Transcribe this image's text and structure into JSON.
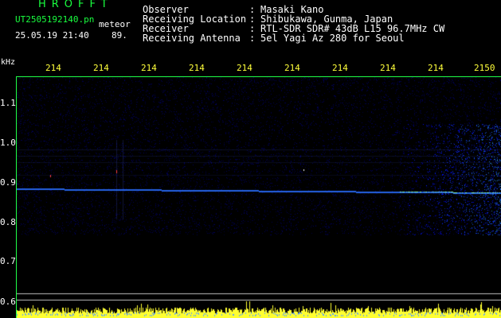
{
  "header": {
    "app_title": "HROFFT",
    "file_name": "UT2505192140.pn",
    "detection_label": "meteor",
    "timestamp": "25.05.19 21:40",
    "count": "89."
  },
  "station_info": [
    {
      "label": "Observer",
      "value": "Masaki Kano"
    },
    {
      "label": "Receiving Location",
      "value": "Shibukawa, Gunma, Japan"
    },
    {
      "label": "Receiver",
      "value": "RTL-SDR SDR# 43dB L15 96.7MHz CW"
    },
    {
      "label": "Receiving Antenna",
      "value": "5el Yagi Az 280 for Seoul"
    }
  ],
  "axis": {
    "y_unit": "kHz",
    "y_ticks": [
      "1.1",
      "1.0",
      "0.9",
      "0.8",
      "0.7",
      "0.6"
    ],
    "x_ticks": [
      "214",
      "214",
      "214",
      "214",
      "214",
      "214",
      "214",
      "214",
      "214",
      "2150"
    ]
  },
  "colors": {
    "text_primary": "#ffffff",
    "accent_green": "#19ff3f",
    "tick_yellow": "#ffff3a",
    "signal_blue": "#2a5bff",
    "carrier_cyan": "#6fe8ff"
  }
}
